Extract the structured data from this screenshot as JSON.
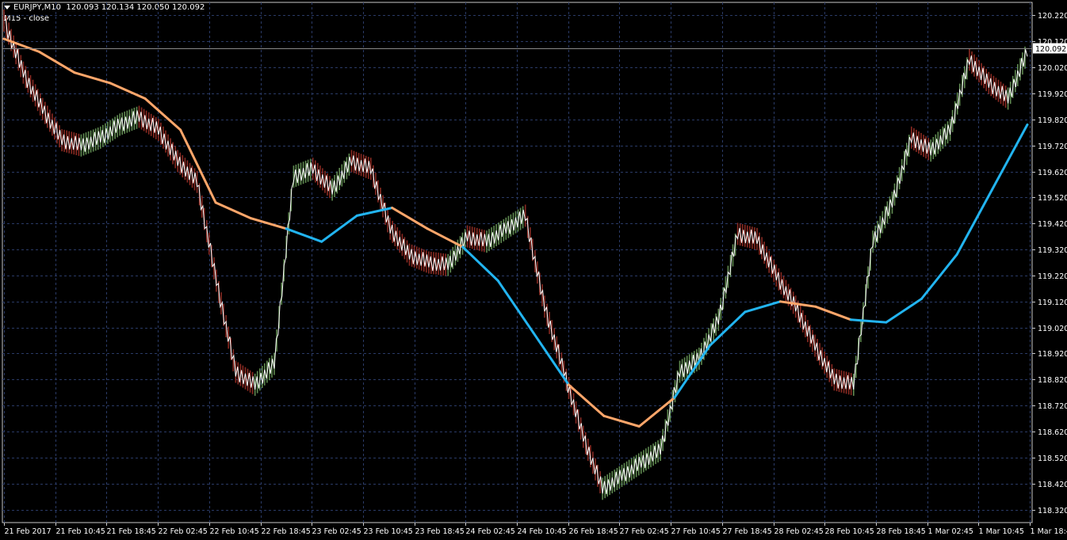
{
  "header": {
    "symbol": "EURJPY,M10",
    "ohlc": "120.093 120.134 120.050 120.092",
    "indicator": "M15 - close"
  },
  "colors": {
    "background": "#000000",
    "grid": "#2a3a66",
    "axis": "#c8c8c8",
    "price_line": "#ffffff",
    "up_band": "#6b9a5a",
    "down_band": "#9a2f26",
    "ma_orange": "#ffa66a",
    "ma_blue": "#22b4f0",
    "current_price_bg": "#ffffff"
  },
  "chart_data": {
    "type": "line",
    "title": "EURJPY,M10",
    "ylim": [
      118.27,
      120.27
    ],
    "y_ticks": [
      "120.220",
      "120.120",
      "120.020",
      "119.920",
      "119.820",
      "119.720",
      "119.620",
      "119.520",
      "119.420",
      "119.320",
      "119.220",
      "119.120",
      "119.020",
      "118.920",
      "118.820",
      "118.720",
      "118.620",
      "118.520",
      "118.420",
      "118.320"
    ],
    "x_ticks": [
      "21 Feb 2017",
      "21 Feb 10:45",
      "21 Feb 18:45",
      "22 Feb 02:45",
      "22 Feb 10:45",
      "22 Feb 18:45",
      "23 Feb 02:45",
      "23 Feb 10:45",
      "23 Feb 18:45",
      "24 Feb 02:45",
      "24 Feb 10:45",
      "26 Feb 18:45",
      "27 Feb 02:45",
      "27 Feb 10:45",
      "27 Feb 18:45",
      "28 Feb 02:45",
      "28 Feb 10:45",
      "28 Feb 18:45",
      "1 Mar 02:45",
      "1 Mar 10:45",
      "1 Mar 18:45"
    ],
    "current_price": "120.092",
    "series": [
      {
        "name": "close",
        "values": [
          120.2,
          120.0,
          119.86,
          119.74,
          119.72,
          119.75,
          119.8,
          119.83,
          119.78,
          119.66,
          119.58,
          119.2,
          118.85,
          118.8,
          118.88,
          119.6,
          119.63,
          119.55,
          119.66,
          119.63,
          119.4,
          119.3,
          119.27,
          119.26,
          119.37,
          119.35,
          119.4,
          119.45,
          119.1,
          118.85,
          118.6,
          118.4,
          118.45,
          118.5,
          118.55,
          118.85,
          118.9,
          119.05,
          119.38,
          119.36,
          119.22,
          119.1,
          118.95,
          118.82,
          118.8,
          119.35,
          119.5,
          119.75,
          119.7,
          119.78,
          120.05,
          119.96,
          119.9,
          120.08
        ]
      },
      {
        "name": "MA",
        "values": [
          120.13,
          120.08,
          120.0,
          119.96,
          119.9,
          119.78,
          119.5,
          119.44,
          119.4,
          119.35,
          119.45,
          119.48,
          119.4,
          119.33,
          119.2,
          119.0,
          118.8,
          118.68,
          118.64,
          118.75,
          118.95,
          119.08,
          119.12,
          119.1,
          119.05,
          119.04,
          119.13,
          119.3,
          119.55,
          119.8
        ]
      }
    ]
  }
}
